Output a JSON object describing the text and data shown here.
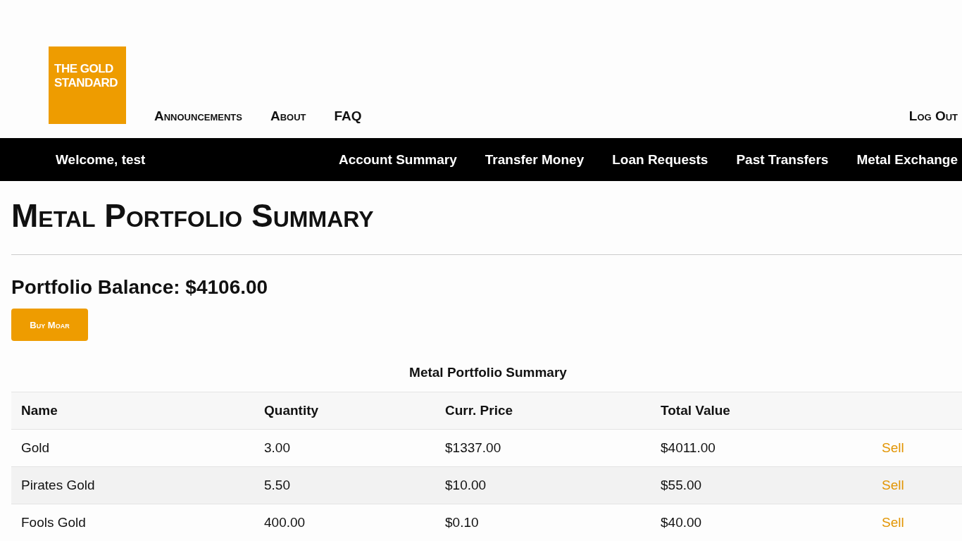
{
  "logo": {
    "text": "THE GOLD STANDARD"
  },
  "top_nav": {
    "links": [
      "Announcements",
      "About",
      "FAQ"
    ],
    "logout": "Log Out"
  },
  "main_nav": {
    "welcome": "Welcome, test",
    "links": [
      "Account Summary",
      "Transfer Money",
      "Loan Requests",
      "Past Transfers",
      "Metal Exchange"
    ]
  },
  "page_title": "Metal Portfolio Summary",
  "balance": "Portfolio Balance: $4106.00",
  "buy_button": "Buy Moar",
  "table": {
    "caption": "Metal Portfolio Summary",
    "columns": [
      "Name",
      "Quantity",
      "Curr. Price",
      "Total Value"
    ],
    "rows": [
      {
        "cells": [
          "Gold",
          "3.00",
          "$1337.00",
          "$4011.00"
        ],
        "action": "Sell"
      },
      {
        "cells": [
          "Pirates Gold",
          "5.50",
          "$10.00",
          "$55.00"
        ],
        "action": "Sell"
      },
      {
        "cells": [
          "Fools Gold",
          "400.00",
          "$0.10",
          "$40.00"
        ],
        "action": "Sell"
      }
    ]
  }
}
